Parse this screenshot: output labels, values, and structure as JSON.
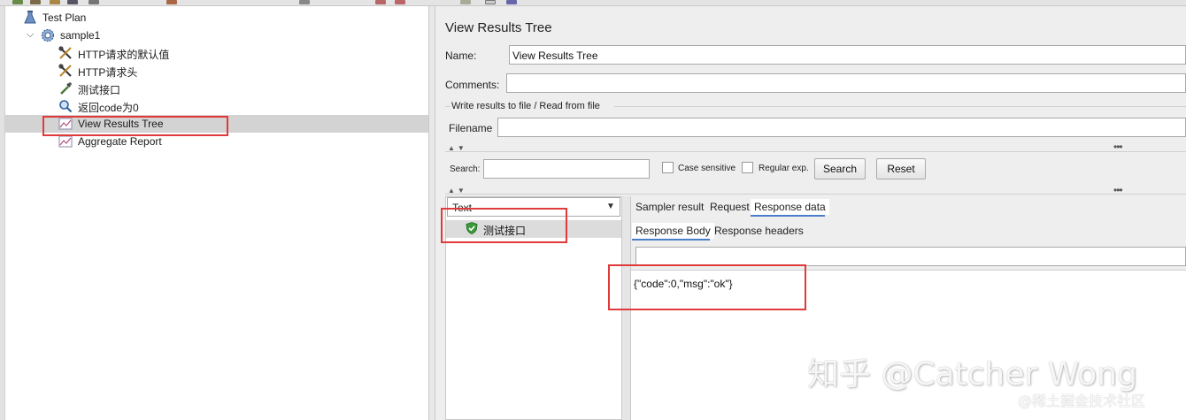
{
  "colors": {
    "selection": "#d3d3d3",
    "annotation_red": "#e03a3a",
    "tab_underline": "#4a7ec9",
    "success_shield": "#3a9a3a"
  },
  "tree": {
    "items": [
      {
        "label": "Test Plan",
        "icon": "test-plan-icon"
      },
      {
        "label": "sample1",
        "icon": "thread-group-gear-icon"
      },
      {
        "label": "HTTP请求的默认值",
        "icon": "wrench-config-icon"
      },
      {
        "label": "HTTP请求头",
        "icon": "wrench-config-icon"
      },
      {
        "label": "测试接口",
        "icon": "sampler-pipette-icon"
      },
      {
        "label": "返回code为0",
        "icon": "assertion-magnifier-icon"
      },
      {
        "label": "View Results Tree",
        "icon": "listener-graph-icon"
      },
      {
        "label": "Aggregate Report",
        "icon": "listener-graph-icon"
      }
    ]
  },
  "panel": {
    "title": "View Results Tree",
    "name_label": "Name:",
    "name_value": "View Results Tree",
    "comments_label": "Comments:",
    "comments_value": "",
    "file_group_label": "Write results to file / Read from file",
    "filename_label": "Filename",
    "filename_value": ""
  },
  "search": {
    "label": "Search:",
    "value": "",
    "case_sensitive_label": "Case sensitive",
    "regular_exp_label": "Regular exp.",
    "search_button": "Search",
    "reset_button": "Reset"
  },
  "results": {
    "renderer_selected": "Text",
    "items": [
      {
        "label": "测试接口",
        "status": "success"
      }
    ]
  },
  "result_tabs": {
    "tabs": [
      "Sampler result",
      "Request",
      "Response data"
    ],
    "active": "Response data",
    "sub_tabs": [
      "Response Body",
      "Response headers"
    ],
    "active_sub": "Response Body"
  },
  "response": {
    "body": "{\"code\":0,\"msg\":\"ok\"}"
  },
  "watermark": {
    "main": "知乎 @Catcher Wong",
    "sub": "@稀土掘金技术社区"
  }
}
